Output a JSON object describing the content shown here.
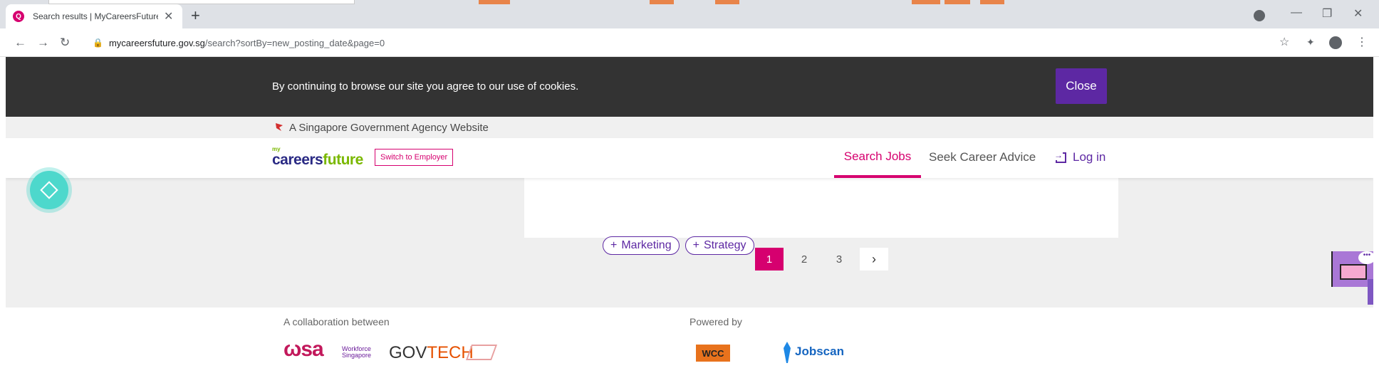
{
  "browser": {
    "tab_title": "Search results | MyCareersFuture",
    "tab_favicon": "Q",
    "new_tab": "+",
    "url_domain": "mycareersfuture.gov.sg",
    "url_path": "/search?sortBy=new_posting_date&page=0"
  },
  "cookie_banner": {
    "message": "By continuing to browse our site you agree to our use of cookies.",
    "close_label": "Close"
  },
  "gov_banner": {
    "text": "A Singapore Government Agency Website"
  },
  "header": {
    "logo_my": "my",
    "logo_careers": "careers",
    "logo_future": "future",
    "switch_label": "Switch to Employer",
    "nav_search": "Search Jobs",
    "nav_advice": "Seek Career Advice",
    "nav_login": "Log in"
  },
  "job_card": {
    "tags": [
      "Marketing",
      "Strategy"
    ]
  },
  "pagination": {
    "pages": [
      "1",
      "2",
      "3"
    ],
    "current": "1",
    "next": "›"
  },
  "footer": {
    "collab_label": "A collaboration between",
    "powered_label": "Powered by",
    "wsg_name": "Workforce Singapore",
    "govtech_gov": "GOV",
    "govtech_tech": "TECH",
    "jobscan": "Jobscan"
  },
  "colors": {
    "brand_magenta": "#d6006f",
    "brand_purple": "#5d28a3",
    "cookie_bg": "#333333"
  }
}
